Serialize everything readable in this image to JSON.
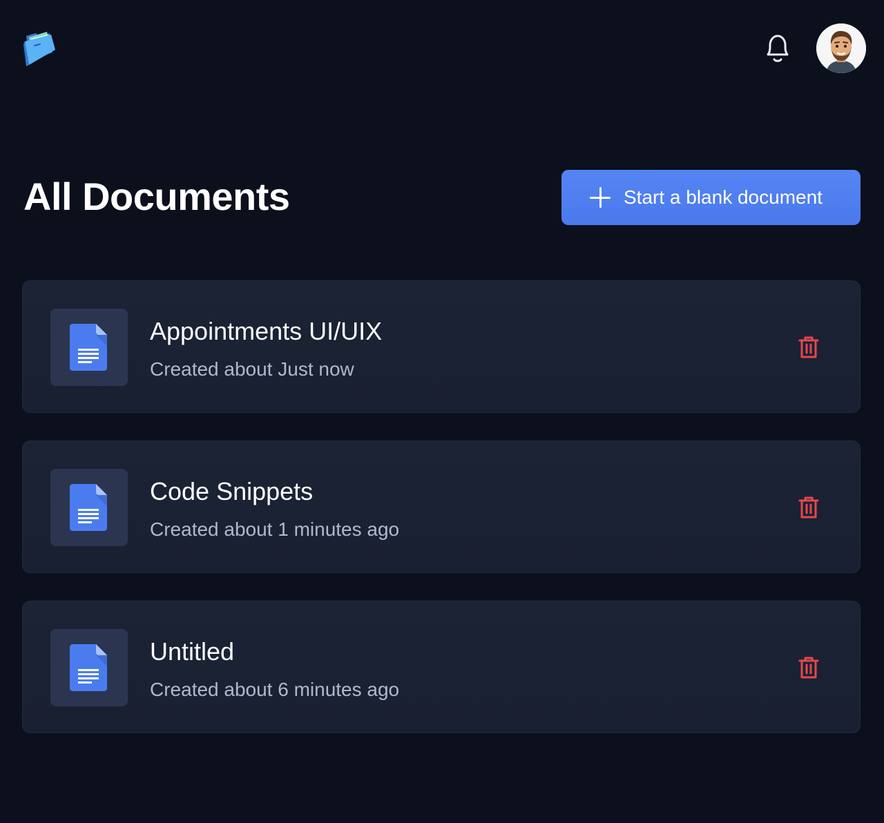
{
  "header": {
    "logo_icon": "folder-logo-icon",
    "notifications_icon": "bell-icon",
    "avatar_icon": "user-avatar"
  },
  "main": {
    "title": "All Documents",
    "new_document_label": "Start a blank document",
    "new_document_icon": "plus-icon"
  },
  "documents": [
    {
      "name": "Appointments UI/UIX",
      "created": "Created about Just now"
    },
    {
      "name": "Code Snippets",
      "created": "Created about 1 minutes ago"
    },
    {
      "name": "Untitled",
      "created": "Created about 6 minutes ago"
    }
  ],
  "colors": {
    "background": "#0b101c",
    "card": "#1c2335",
    "accent": "#4f7ff0",
    "delete": "#e5484d",
    "doc_icon": "#4a7cf0"
  }
}
